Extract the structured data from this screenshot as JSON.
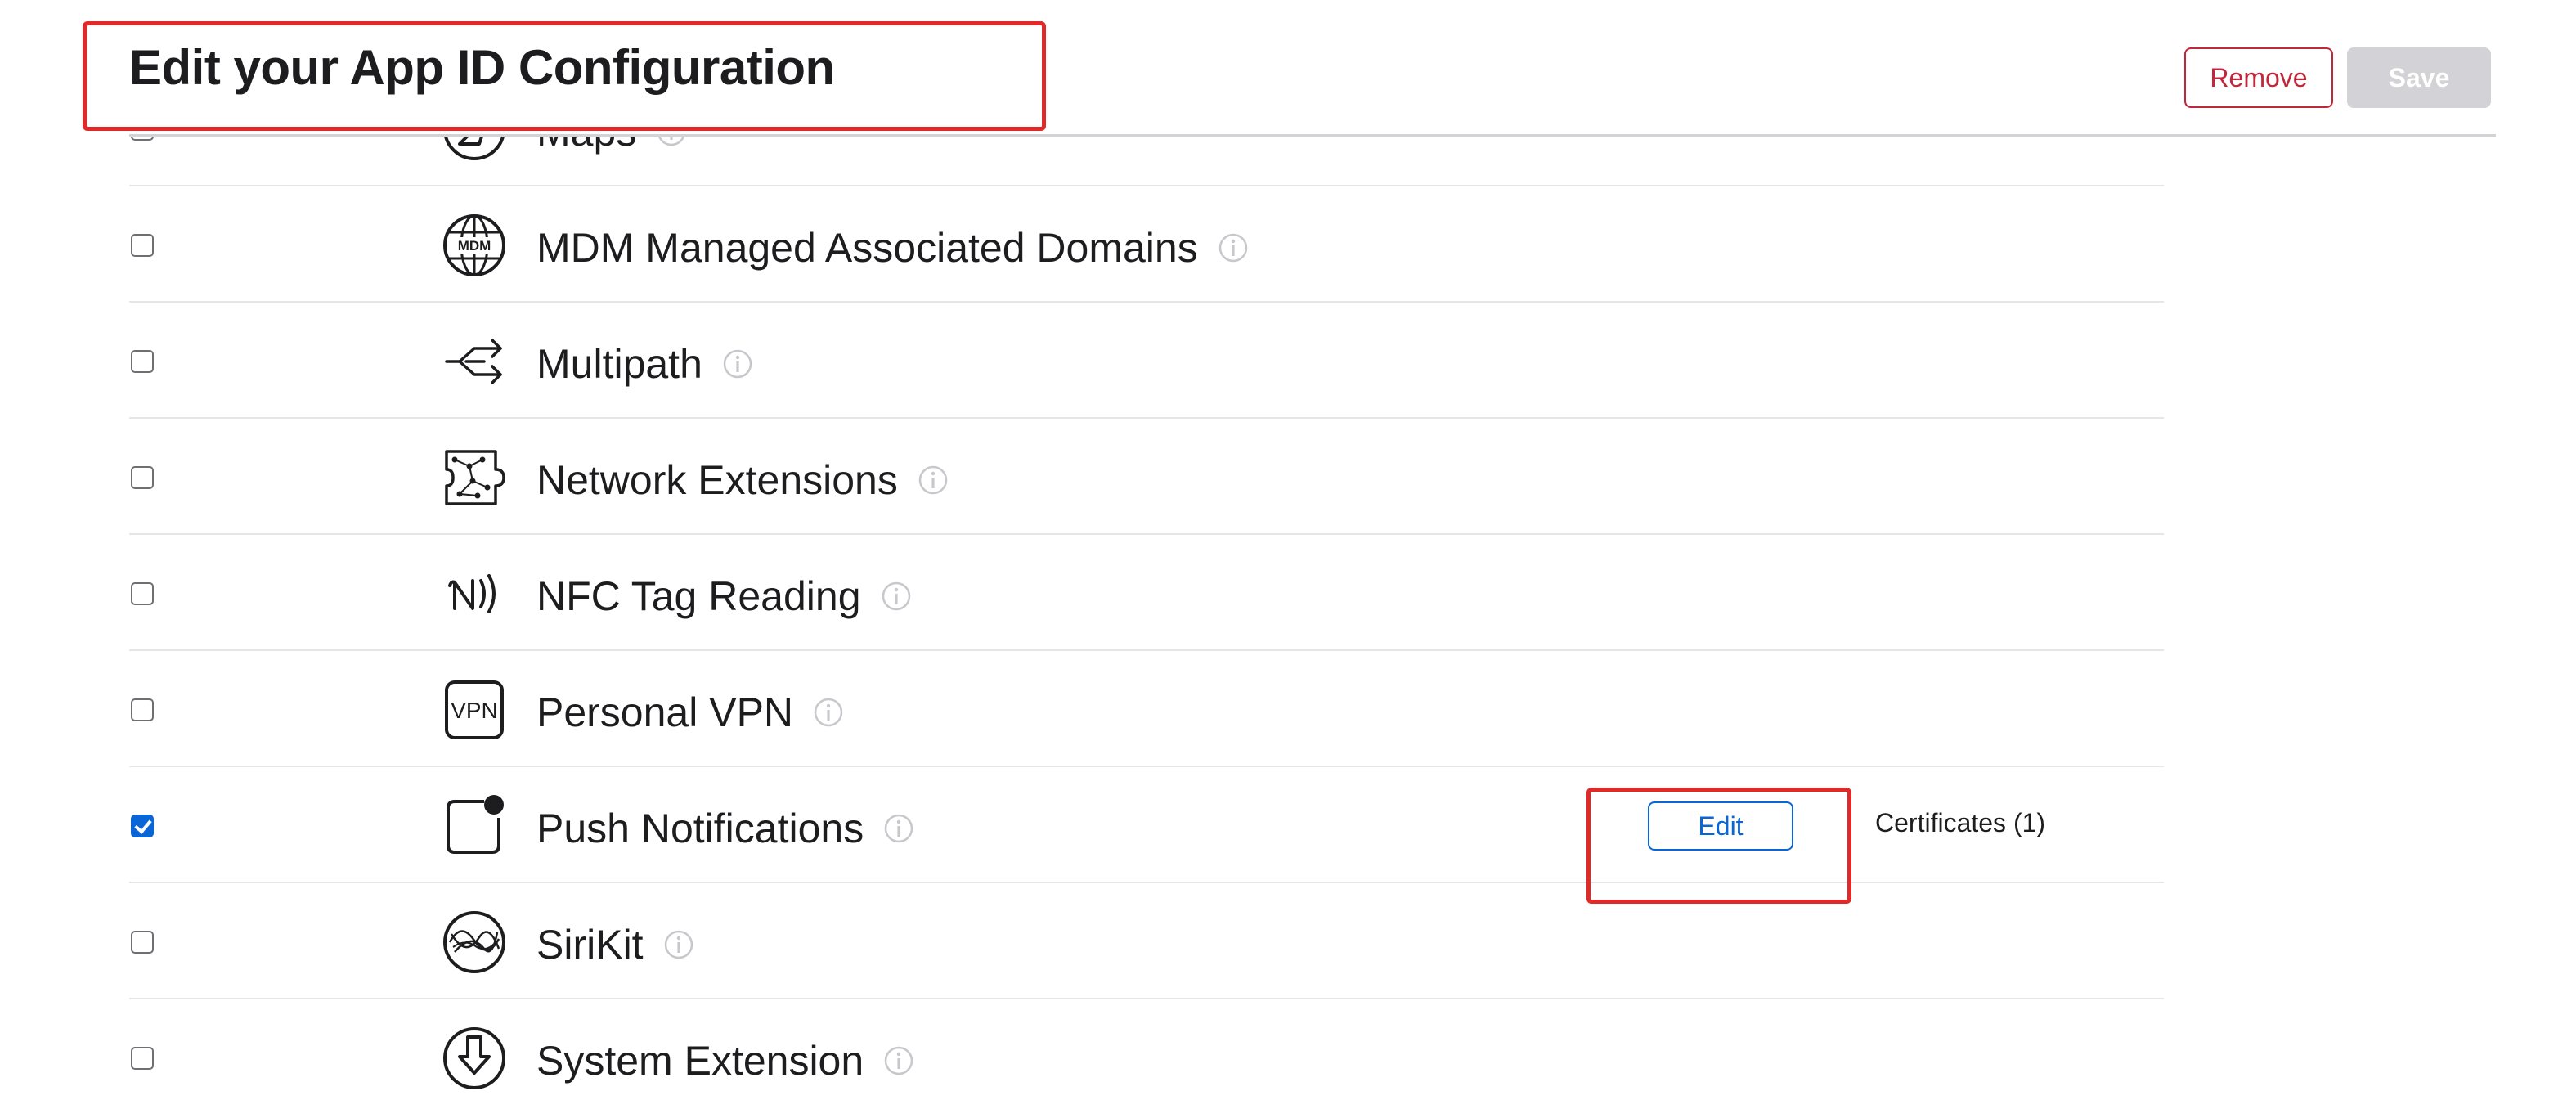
{
  "header": {
    "title": "Edit your App ID Configuration",
    "remove_label": "Remove",
    "save_label": "Save"
  },
  "capabilities": [
    {
      "name": "Maps",
      "icon": "maps-icon",
      "checked": false
    },
    {
      "name": "MDM Managed Associated Domains",
      "icon": "mdm-globe-icon",
      "checked": false
    },
    {
      "name": "Multipath",
      "icon": "multipath-arrows-icon",
      "checked": false
    },
    {
      "name": "Network Extensions",
      "icon": "network-extensions-icon",
      "checked": false
    },
    {
      "name": "NFC Tag Reading",
      "icon": "nfc-icon",
      "checked": false
    },
    {
      "name": "Personal VPN",
      "icon": "vpn-icon",
      "checked": false
    },
    {
      "name": "Push Notifications",
      "icon": "push-notification-icon",
      "checked": true
    },
    {
      "name": "SiriKit",
      "icon": "sirikit-icon",
      "checked": false
    },
    {
      "name": "System Extension",
      "icon": "system-extension-icon",
      "checked": false
    }
  ],
  "push_notifications": {
    "edit_label": "Edit",
    "certificates_text": "Certificates (1)"
  },
  "icon_text": {
    "mdm": "MDM",
    "vpn": "VPN"
  },
  "colors": {
    "accent_blue": "#0a66d6",
    "remove_red": "#c2263a",
    "save_disabled": "#d2d2d7",
    "annotation_red": "#e02a2a"
  }
}
